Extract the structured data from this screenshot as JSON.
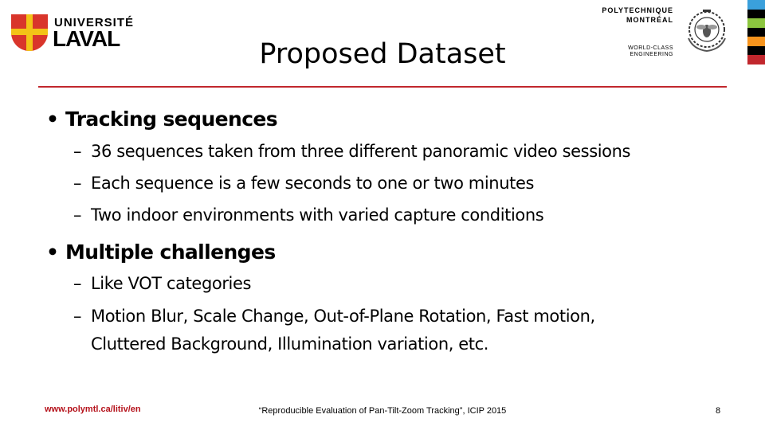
{
  "header": {
    "left_logo": {
      "line1": "UNIVERSITÉ",
      "line2": "LAVAL"
    },
    "title": "Proposed Dataset",
    "right_logo": {
      "line1": "POLYTECHNIQUE",
      "line2": "MONTRÉAL",
      "tagline1": "WORLD-CLASS",
      "tagline2": "ENGINEERING"
    },
    "stripe_colors": [
      "#3aa0dc",
      "#000000",
      "#8cc63f",
      "#000000",
      "#f7941d",
      "#000000",
      "#c1272d"
    ],
    "rule_color": "#c1272d"
  },
  "content": {
    "sections": [
      {
        "heading": "Tracking sequences",
        "items": [
          "36 sequences taken from three different panoramic video sessions",
          "Each sequence is a few seconds to one or two minutes",
          "Two indoor environments with varied capture conditions"
        ]
      },
      {
        "heading": "Multiple challenges",
        "items": [
          "Like VOT categories",
          "Motion Blur, Scale Change, Out-of-Plane Rotation, Fast motion,"
        ],
        "continuation": "Cluttered Background, Illumination variation, etc."
      }
    ]
  },
  "footer": {
    "url": "www.polymtl.ca/litiv/en",
    "citation": "“Reproducible Evaluation of Pan-Tilt-Zoom Tracking”, ICIP 2015",
    "page_number": "8"
  }
}
